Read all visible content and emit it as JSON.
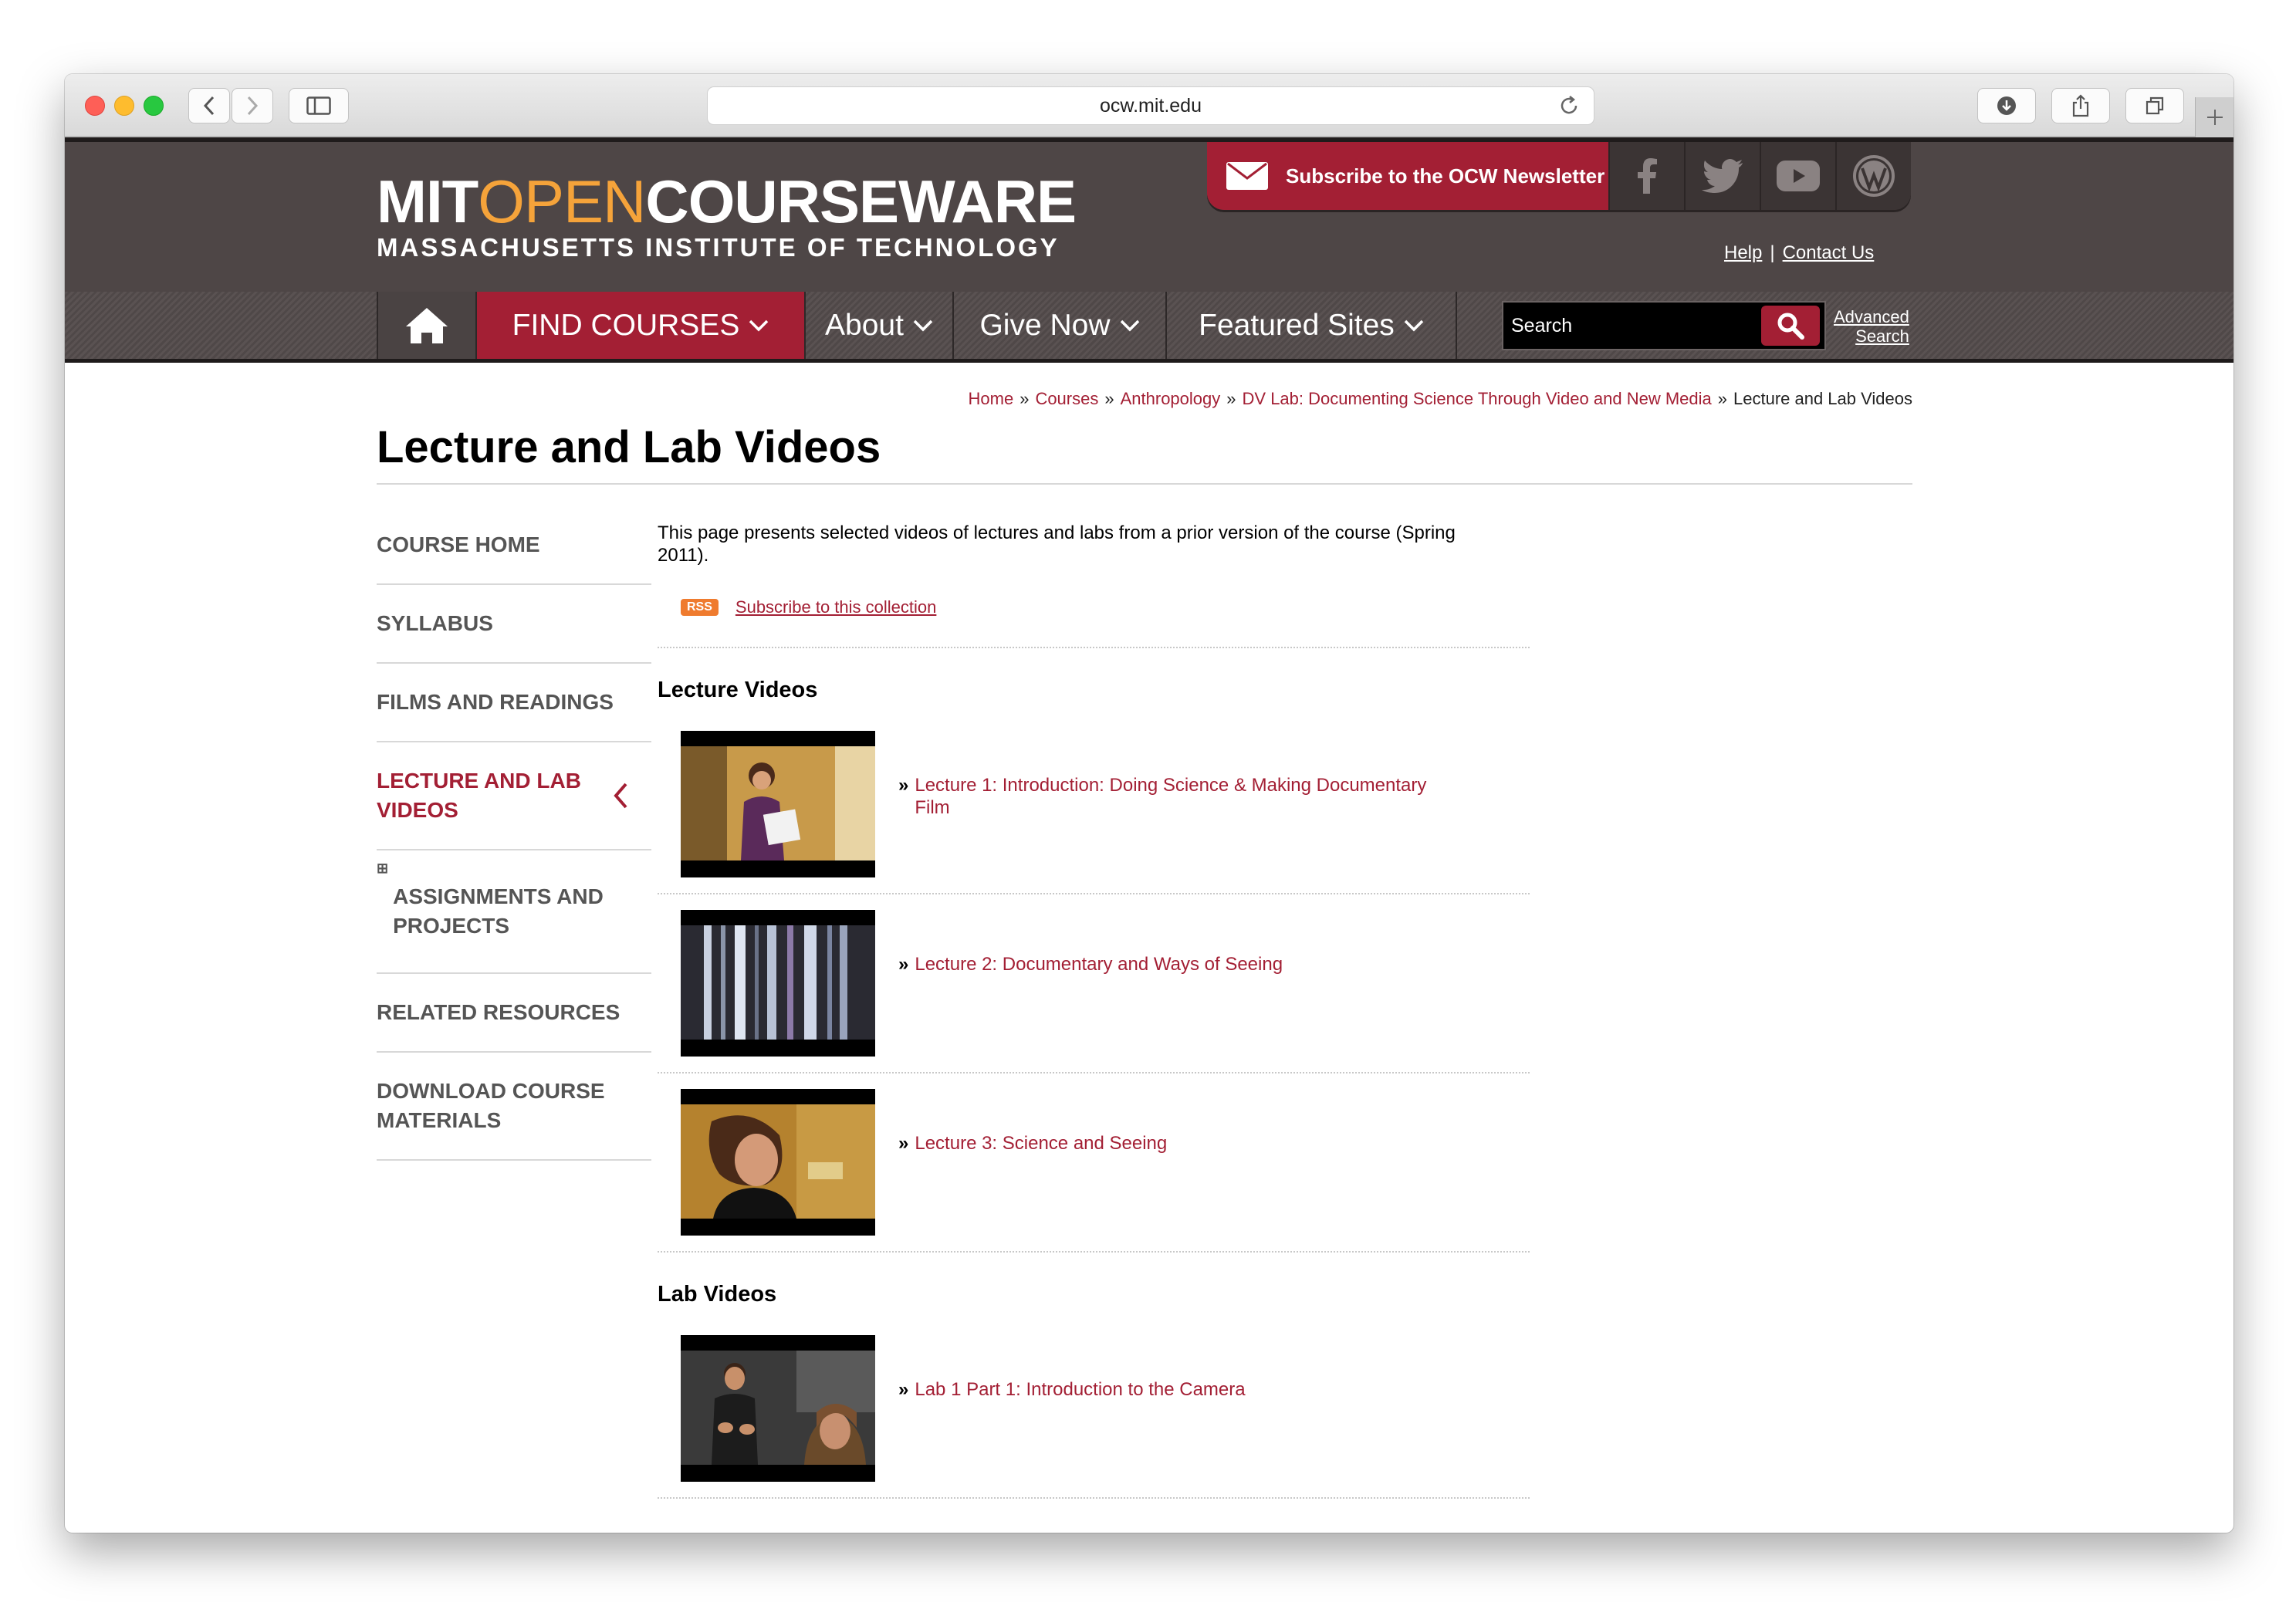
{
  "browser": {
    "url": "ocw.mit.edu",
    "traffic_lights": [
      "#fe5f57",
      "#febc2e",
      "#28c840"
    ]
  },
  "header": {
    "logo_mit": "MIT",
    "logo_open": "OPEN",
    "logo_courseware": "COURSEWARE",
    "logo_subtitle": "MASSACHUSETTS INSTITUTE OF TECHNOLOGY",
    "newsletter_label": "Subscribe to the OCW Newsletter",
    "social_icons": [
      "facebook-icon",
      "twitter-icon",
      "youtube-icon",
      "wordpress-icon"
    ],
    "help_label": "Help",
    "contact_label": "Contact Us",
    "colors": {
      "brand_red": "#a31f34",
      "header_gray": "#4e4646",
      "logo_orange": "#f5a33a"
    }
  },
  "nav": {
    "home_icon": "home-icon",
    "find_courses": "FIND COURSES",
    "about": "About",
    "give_now": "Give Now",
    "featured_sites": "Featured Sites",
    "search_placeholder": "Search",
    "advanced_line1": "Advanced",
    "advanced_line2": "Search"
  },
  "breadcrumb": {
    "items": [
      "Home",
      "Courses",
      "Anthropology",
      "DV Lab: Documenting Science Through Video and New Media"
    ],
    "current": "Lecture and Lab Videos",
    "separator": "»"
  },
  "page": {
    "title": "Lecture and Lab Videos",
    "intro": "This page presents selected videos of lectures and labs from a prior version of the course (Spring 2011).",
    "rss_badge": "RSS",
    "rss_link": "Subscribe to this collection"
  },
  "sidebar": {
    "items": [
      {
        "label": "COURSE HOME"
      },
      {
        "label": "SYLLABUS"
      },
      {
        "label": "FILMS AND READINGS"
      },
      {
        "label_line1": "LECTURE AND LAB",
        "label_line2": "VIDEOS",
        "active": true
      },
      {
        "label_line1": "ASSIGNMENTS AND",
        "label_line2": "PROJECTS",
        "expand_icon": "⊞"
      },
      {
        "label": "RELATED RESOURCES"
      },
      {
        "label_line1": "DOWNLOAD COURSE",
        "label_line2": "MATERIALS"
      }
    ]
  },
  "lecture_videos": {
    "heading": "Lecture Videos",
    "items": [
      {
        "line1": "Lecture 1: Introduction: Doing Science & Making Documentary",
        "line2": "Film"
      },
      {
        "line1": "Lecture 2: Documentary and Ways of Seeing"
      },
      {
        "line1": "Lecture 3: Science and Seeing"
      }
    ]
  },
  "lab_videos": {
    "heading": "Lab Videos",
    "items": [
      {
        "line1": "Lab 1 Part 1: Introduction to the Camera"
      }
    ]
  }
}
